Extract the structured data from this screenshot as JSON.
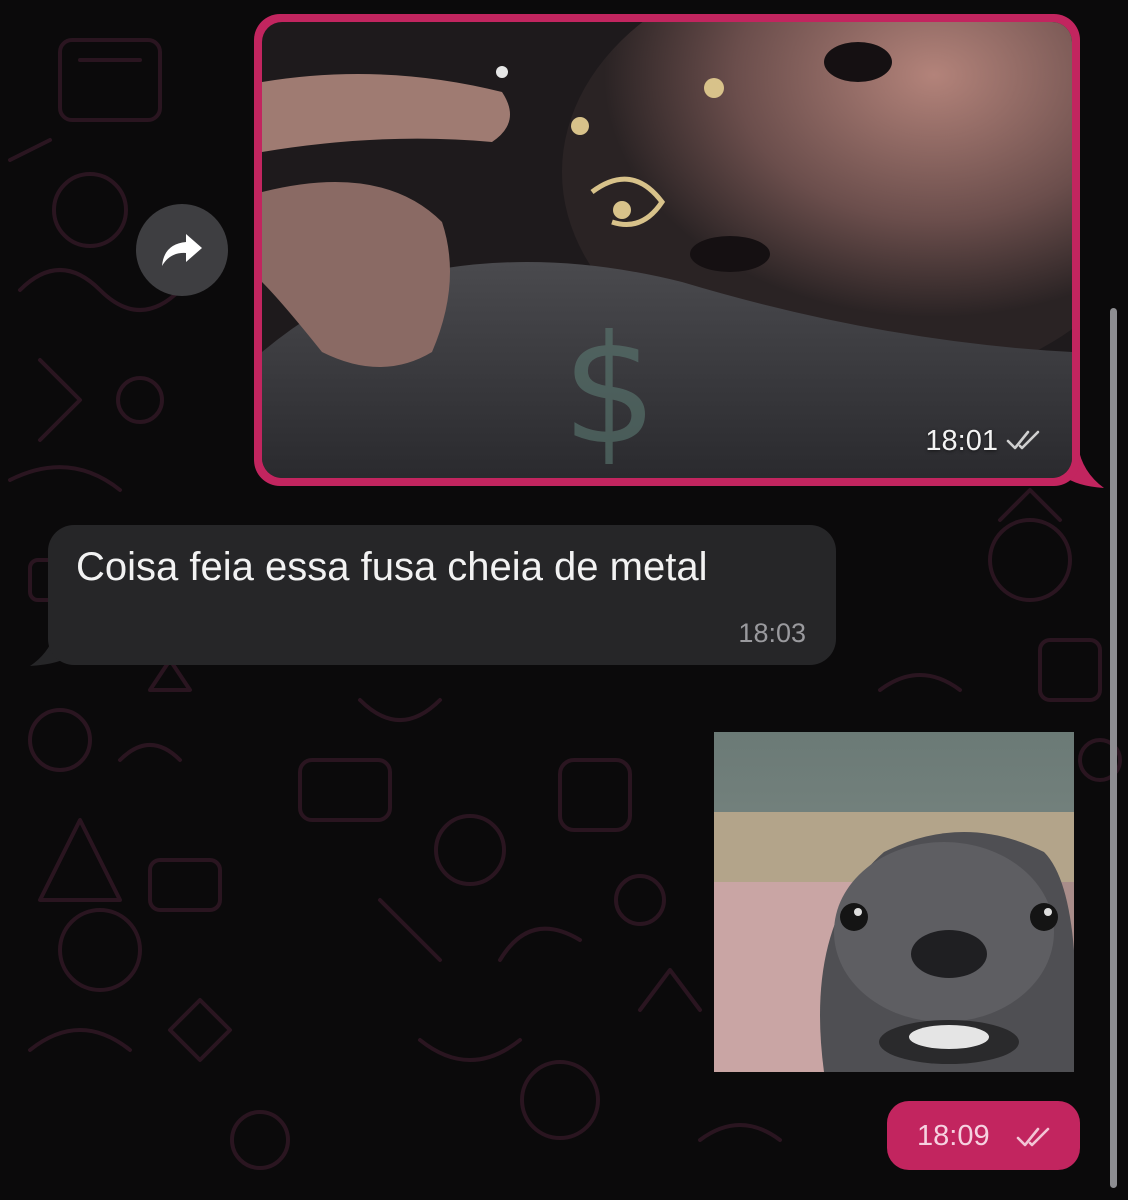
{
  "messages": [
    {
      "type": "image",
      "direction": "outgoing",
      "time": "18:01",
      "status_icon": "double-check-icon"
    },
    {
      "type": "text",
      "direction": "incoming",
      "text": "Coisa feia essa fusa cheia de metal",
      "time": "18:03"
    },
    {
      "type": "sticker",
      "direction": "outgoing"
    },
    {
      "type": "time-only",
      "direction": "outgoing",
      "time": "18:09",
      "status_icon": "double-check-icon"
    }
  ],
  "forward_button": {
    "icon": "forward-arrow-icon"
  },
  "colors": {
    "background": "#0b0a0b",
    "outgoing_bubble": "#c2255f",
    "incoming_bubble": "#262628",
    "wallpaper_doodle": "#2a1520",
    "scrollbar": "#8d8d91"
  }
}
